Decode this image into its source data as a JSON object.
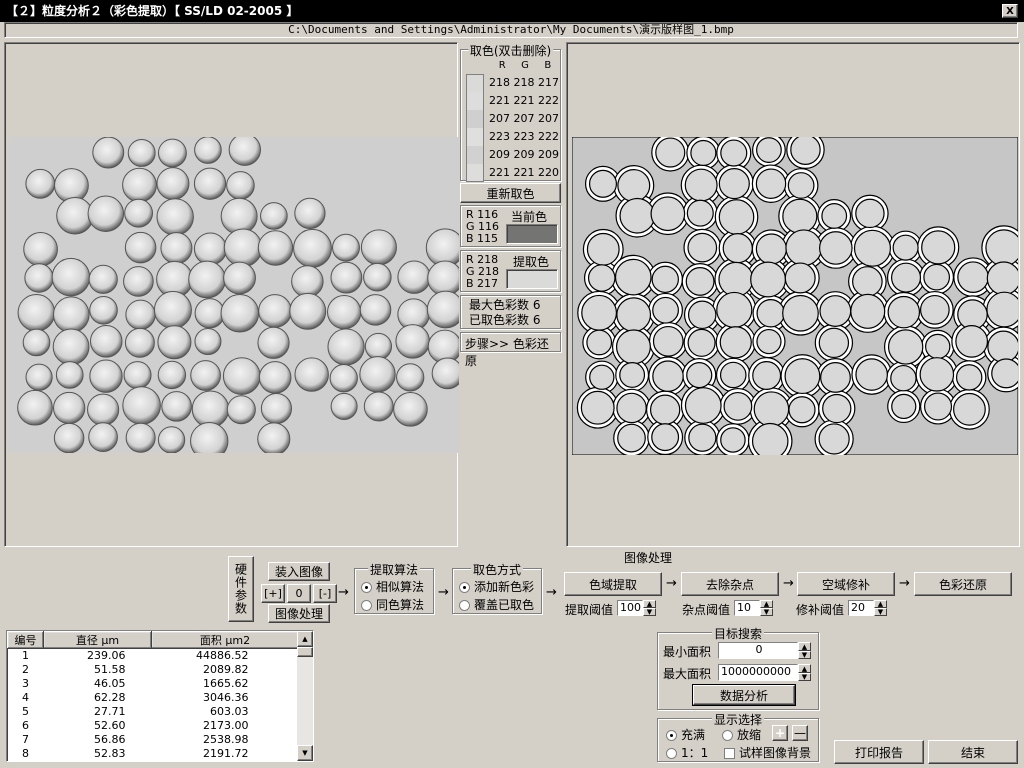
{
  "window": {
    "title": "【２】粒度分析２（彩色提取）【 SS/LD 02-2005 】",
    "close": "X"
  },
  "filepath": "C:\\Documents and Settings\\Administrator\\My Documents\\演示版样图_1.bmp",
  "picked": {
    "title": "取色(双击删除)",
    "headers": [
      "R",
      "G",
      "B"
    ],
    "rows": [
      {
        "r": "218",
        "g": "218",
        "b": "217",
        "color": "#dadad9"
      },
      {
        "r": "221",
        "g": "221",
        "b": "222",
        "color": "#ddddde"
      },
      {
        "r": "207",
        "g": "207",
        "b": "207",
        "color": "#cfcfcf"
      },
      {
        "r": "223",
        "g": "223",
        "b": "222",
        "color": "#dfdfde"
      },
      {
        "r": "209",
        "g": "209",
        "b": "209",
        "color": "#d1d1d1"
      },
      {
        "r": "221",
        "g": "221",
        "b": "220",
        "color": "#ddddd c"
      }
    ],
    "repick": "重新取色"
  },
  "current": {
    "label": "当前色",
    "r": "R  116",
    "g": "G  116",
    "b": "B  115",
    "color": "#747473"
  },
  "extract": {
    "label": "提取色",
    "r": "R  218",
    "g": "G  218",
    "b": "B  217",
    "color": "#dadad9"
  },
  "counts": {
    "max": "最大色彩数  6",
    "taken": "已取色彩数  6"
  },
  "step": "步骤>>  色彩还原",
  "hardware": "硬件参数",
  "load": {
    "load": "装入图像",
    "plus": "[+]",
    "zero": "0",
    "minus": "[-]",
    "process": "图像处理"
  },
  "algo": {
    "title": "提取算法",
    "opt1": "相似算法",
    "opt2": "同色算法"
  },
  "mode": {
    "title": "取色方式",
    "opt1": "添加新色彩",
    "opt2": "覆盖已取色"
  },
  "imgproc": {
    "title": "图像处理",
    "b1": "色域提取",
    "b2": "去除杂点",
    "b3": "空域修补",
    "b4": "色彩还原",
    "t1l": "提取阈值",
    "t1v": "100",
    "t2l": "杂点阈值",
    "t2v": "10",
    "t3l": "修补阈值",
    "t3v": "20"
  },
  "table": {
    "headers": [
      "编号",
      "直径  μm",
      "面积  μm2"
    ],
    "rows": [
      [
        "1",
        "239.06",
        "44886.52"
      ],
      [
        "2",
        "51.58",
        "2089.82"
      ],
      [
        "3",
        "46.05",
        "1665.62"
      ],
      [
        "4",
        "62.28",
        "3046.36"
      ],
      [
        "5",
        "27.71",
        "603.03"
      ],
      [
        "6",
        "52.60",
        "2173.00"
      ],
      [
        "7",
        "56.86",
        "2538.98"
      ],
      [
        "8",
        "52.83",
        "2191.72"
      ]
    ]
  },
  "search": {
    "title": "目标搜索",
    "minl": "最小面积",
    "minv": "0",
    "maxl": "最大面积",
    "maxv": "1000000000",
    "analyze": "数据分析"
  },
  "display": {
    "title": "显示选择",
    "fill": "充满",
    "scale": "放缩",
    "one": "1：1",
    "bg": "试样图像背景",
    "zin": "+",
    "zout": "—"
  },
  "print": "打印报告",
  "end": "结束"
}
